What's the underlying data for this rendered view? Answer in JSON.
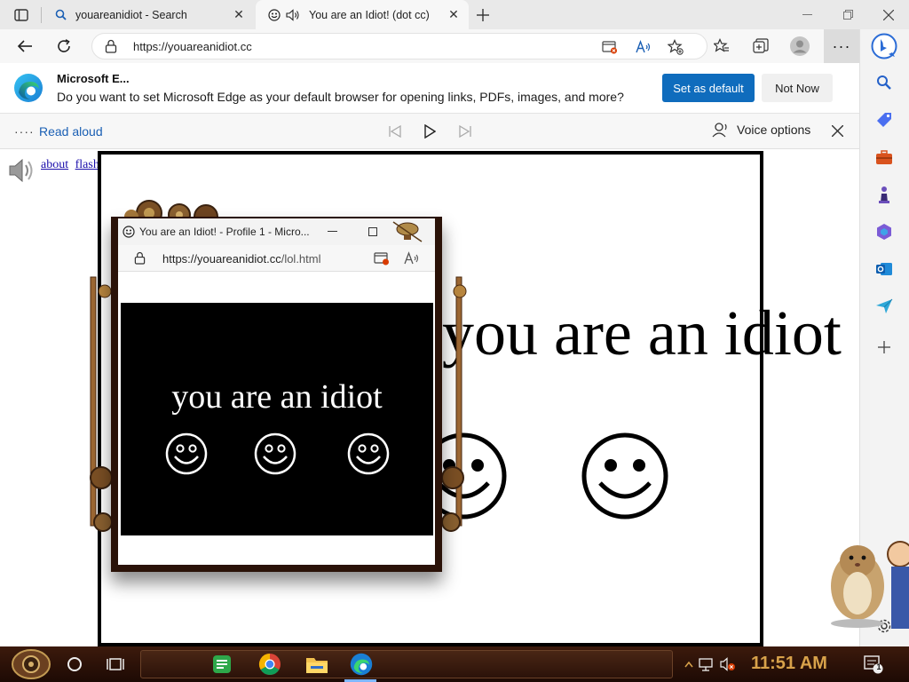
{
  "tabs": [
    {
      "title": "youareanidiot - Search",
      "icon": "search-icon",
      "active": false
    },
    {
      "title": "You are an Idiot! (dot cc)",
      "icon": "smiley-icon",
      "active": true
    }
  ],
  "address_bar": {
    "url": "https://youareanidiot.cc"
  },
  "infobar": {
    "title": "Microsoft E...",
    "message": "Do you want to set Microsoft Edge as your default browser for opening links, PDFs, images, and more?",
    "primary_button": "Set as default",
    "secondary_button": "Not Now"
  },
  "read_aloud": {
    "label": "Read aloud",
    "voice_options": "Voice options"
  },
  "page": {
    "links": [
      "about",
      "flash"
    ],
    "heading": "you are an idiot"
  },
  "popup": {
    "title": "You are an Idiot! - Profile 1 - Micro...",
    "url_domain": "https://youareanidiot.cc",
    "url_path": "/lol.html",
    "text": "you are an idiot"
  },
  "taskbar": {
    "clock": "11:51 AM",
    "notification_count": "1"
  },
  "colors": {
    "accent": "#0f6cbd",
    "link": "#1a0dab",
    "taskbar": "#2b1209",
    "clock": "#d8a24a"
  }
}
